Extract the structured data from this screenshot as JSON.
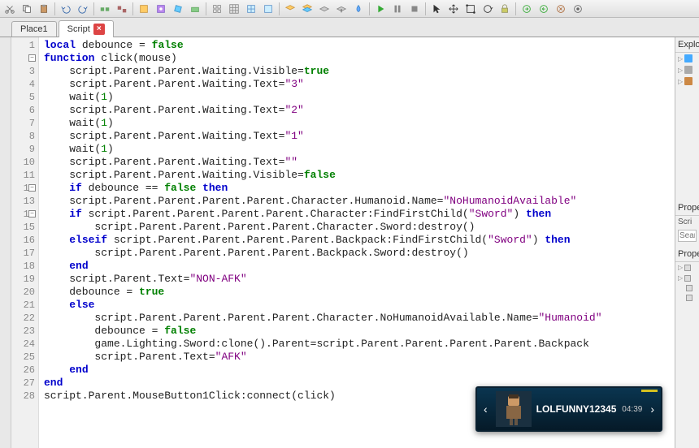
{
  "tabs": [
    {
      "label": "Place1"
    },
    {
      "label": "Script"
    }
  ],
  "rightpanel": {
    "explorer": "Explor",
    "properties": "Prope",
    "scri": "Scri",
    "search_ph": "Searc"
  },
  "notify": {
    "username": "LOLFUNNY12345",
    "time": "04:39"
  },
  "code": {
    "lines": [
      {
        "n": "1",
        "fold": false,
        "html": "<span class='kw'>local</span> debounce = <span class='bool'>false</span>"
      },
      {
        "n": "2",
        "fold": true,
        "html": "<span class='kw'>function</span> click(mouse)"
      },
      {
        "n": "3",
        "fold": false,
        "html": "    script.Parent.Parent.Waiting.Visible=<span class='bool'>true</span>"
      },
      {
        "n": "4",
        "fold": false,
        "html": "    script.Parent.Parent.Waiting.Text=<span class='str'>\"3\"</span>"
      },
      {
        "n": "5",
        "fold": false,
        "html": "    wait(<span class='num'>1</span>)"
      },
      {
        "n": "6",
        "fold": false,
        "html": "    script.Parent.Parent.Waiting.Text=<span class='str'>\"2\"</span>"
      },
      {
        "n": "7",
        "fold": false,
        "html": "    wait(<span class='num'>1</span>)"
      },
      {
        "n": "8",
        "fold": false,
        "html": "    script.Parent.Parent.Waiting.Text=<span class='str'>\"1\"</span>"
      },
      {
        "n": "9",
        "fold": false,
        "html": "    wait(<span class='num'>1</span>)"
      },
      {
        "n": "10",
        "fold": false,
        "html": "    script.Parent.Parent.Waiting.Text=<span class='str'>\"\"</span>"
      },
      {
        "n": "11",
        "fold": false,
        "html": "    script.Parent.Parent.Waiting.Visible=<span class='bool'>false</span>"
      },
      {
        "n": "12",
        "fold": true,
        "html": "    <span class='kw'>if</span> debounce == <span class='bool'>false</span> <span class='kw'>then</span>"
      },
      {
        "n": "13",
        "fold": false,
        "html": "    script.Parent.Parent.Parent.Parent.Character.Humanoid.Name=<span class='str'>\"NoHumanoidAvailable\"</span>"
      },
      {
        "n": "14",
        "fold": true,
        "html": "    <span class='kw'>if</span> script.Parent.Parent.Parent.Parent.Character:FindFirstChild(<span class='str'>\"Sword\"</span>) <span class='kw'>then</span>"
      },
      {
        "n": "15",
        "fold": false,
        "html": "        script.Parent.Parent.Parent.Parent.Character.Sword:destroy()"
      },
      {
        "n": "16",
        "fold": false,
        "html": "    <span class='kw'>elseif</span> script.Parent.Parent.Parent.Parent.Backpack:FindFirstChild(<span class='str'>\"Sword\"</span>) <span class='kw'>then</span>"
      },
      {
        "n": "17",
        "fold": false,
        "html": "        script.Parent.Parent.Parent.Parent.Backpack.Sword:destroy()"
      },
      {
        "n": "18",
        "fold": false,
        "html": "    <span class='kw'>end</span>"
      },
      {
        "n": "19",
        "fold": false,
        "html": "    script.Parent.Text=<span class='str'>\"NON-AFK\"</span>"
      },
      {
        "n": "20",
        "fold": false,
        "html": "    debounce = <span class='bool'>true</span>"
      },
      {
        "n": "21",
        "fold": false,
        "html": "    <span class='kw'>else</span>"
      },
      {
        "n": "22",
        "fold": false,
        "html": "        script.Parent.Parent.Parent.Parent.Character.NoHumanoidAvailable.Name=<span class='str'>\"Humanoid\"</span>"
      },
      {
        "n": "23",
        "fold": false,
        "html": "        debounce = <span class='bool'>false</span>"
      },
      {
        "n": "24",
        "fold": false,
        "html": "        game.Lighting.Sword:clone().Parent=script.Parent.Parent.Parent.Parent.Backpack"
      },
      {
        "n": "25",
        "fold": false,
        "html": "        script.Parent.Text=<span class='str'>\"AFK\"</span>"
      },
      {
        "n": "26",
        "fold": false,
        "html": "    <span class='kw'>end</span>"
      },
      {
        "n": "27",
        "fold": false,
        "html": "<span class='kw'>end</span>"
      },
      {
        "n": "28",
        "fold": false,
        "html": "script.Parent.MouseButton1Click:connect(click)"
      }
    ]
  }
}
